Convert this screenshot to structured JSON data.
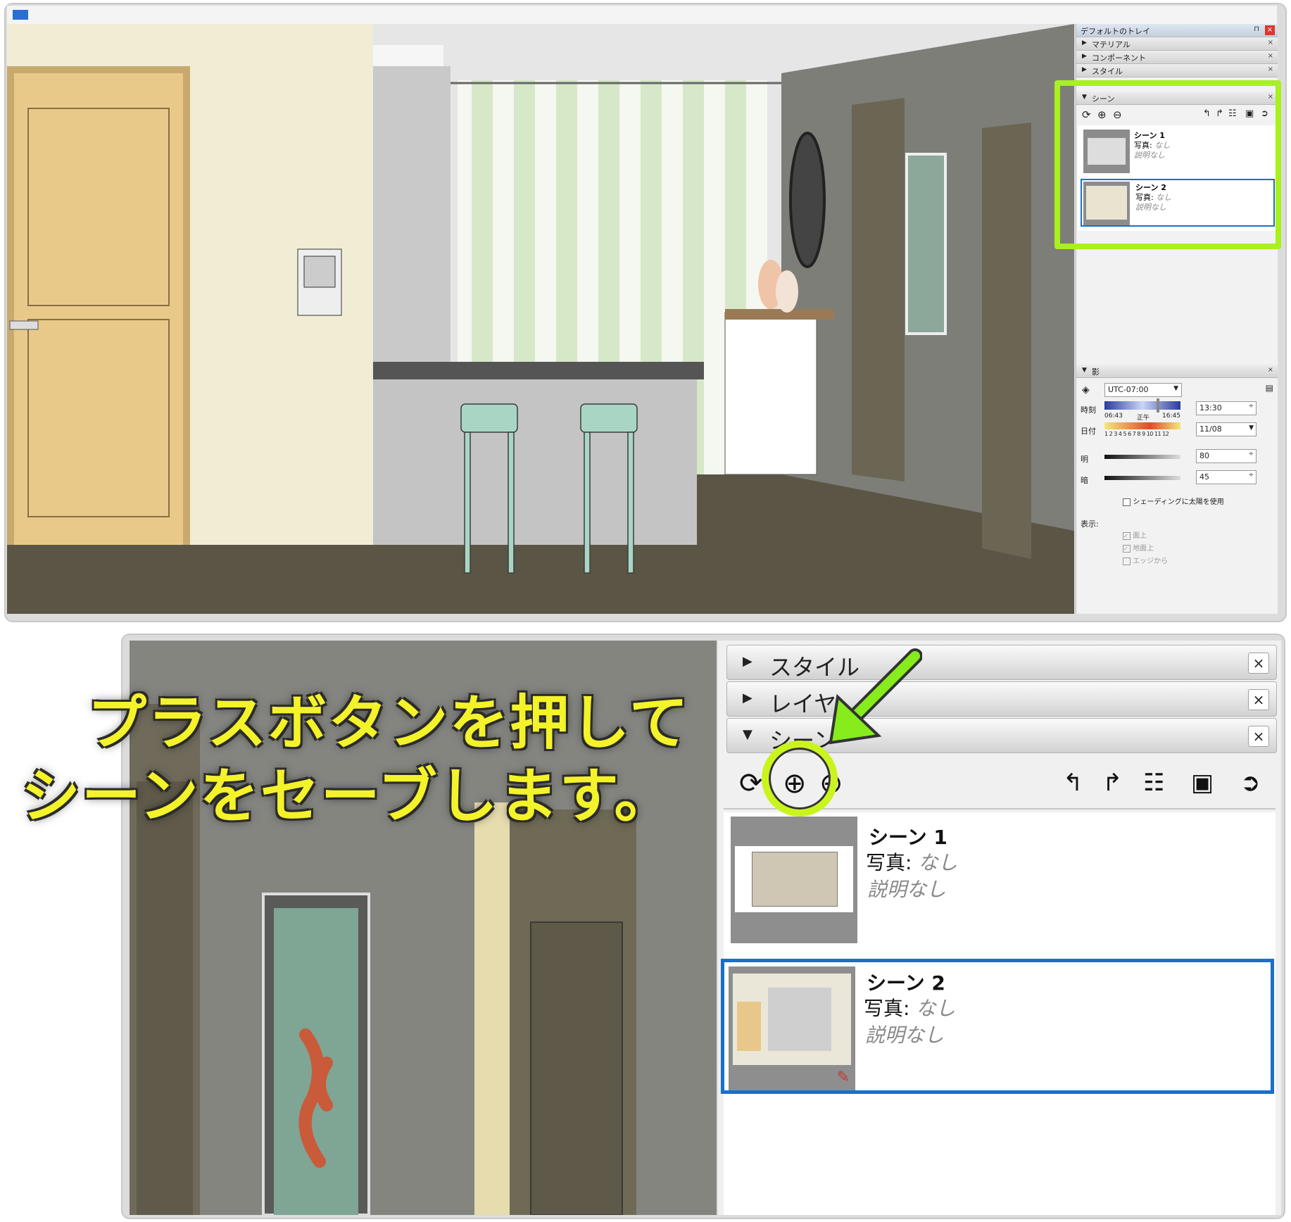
{
  "top_window": {
    "tray_title": "デフォルトのトレイ",
    "panels": [
      {
        "label": "マテリアル",
        "collapsed": true
      },
      {
        "label": "コンポーネント",
        "collapsed": true
      },
      {
        "label": "スタイル",
        "collapsed": true
      },
      {
        "label": "シーン",
        "collapsed": false
      }
    ],
    "scenes": [
      {
        "name": "シーン 1",
        "photo_label": "写真:",
        "photo_value": "なし",
        "description": "説明なし"
      },
      {
        "name": "シーン 2",
        "photo_label": "写真:",
        "photo_value": "なし",
        "description": "説明なし"
      }
    ],
    "shadows": {
      "panel_label": "影",
      "timezone": "UTC-07:00",
      "time_label": "時刻",
      "time_start": "06:43",
      "time_noon": "正午",
      "time_end": "16:45",
      "time_value": "13:30",
      "date_label": "日付",
      "months": "1 2 3 4 5 6 7 8 9 10 11 12",
      "date_value": "11/08",
      "light_label": "明",
      "light_value": "80",
      "dark_label": "暗",
      "dark_value": "45",
      "use_sun_label": "シェーディングに太陽を使用",
      "display_label": "表示:",
      "on_faces": "面上",
      "on_ground": "地面上",
      "from_edges": "エッジから"
    }
  },
  "bottom_window": {
    "panels": [
      {
        "label": "スタイル",
        "collapsed": true
      },
      {
        "label": "レイヤ",
        "collapsed": true
      },
      {
        "label": "シーン",
        "collapsed": false
      }
    ],
    "close_glyph": "×",
    "scenes": [
      {
        "name": "シーン 1",
        "photo_label": "写真:",
        "photo_value": "なし",
        "description": "説明なし"
      },
      {
        "name": "シーン 2",
        "photo_label": "写真:",
        "photo_value": "なし",
        "description": "説明なし"
      }
    ]
  },
  "callout": {
    "line1": "プラスボタンを押して",
    "line2": "シーンをセーブします。"
  },
  "colors": {
    "highlight": "#a8f01e",
    "arrow": "#86ec1c",
    "selection": "#1a6fc8",
    "callout_text": "#f4f32a"
  }
}
